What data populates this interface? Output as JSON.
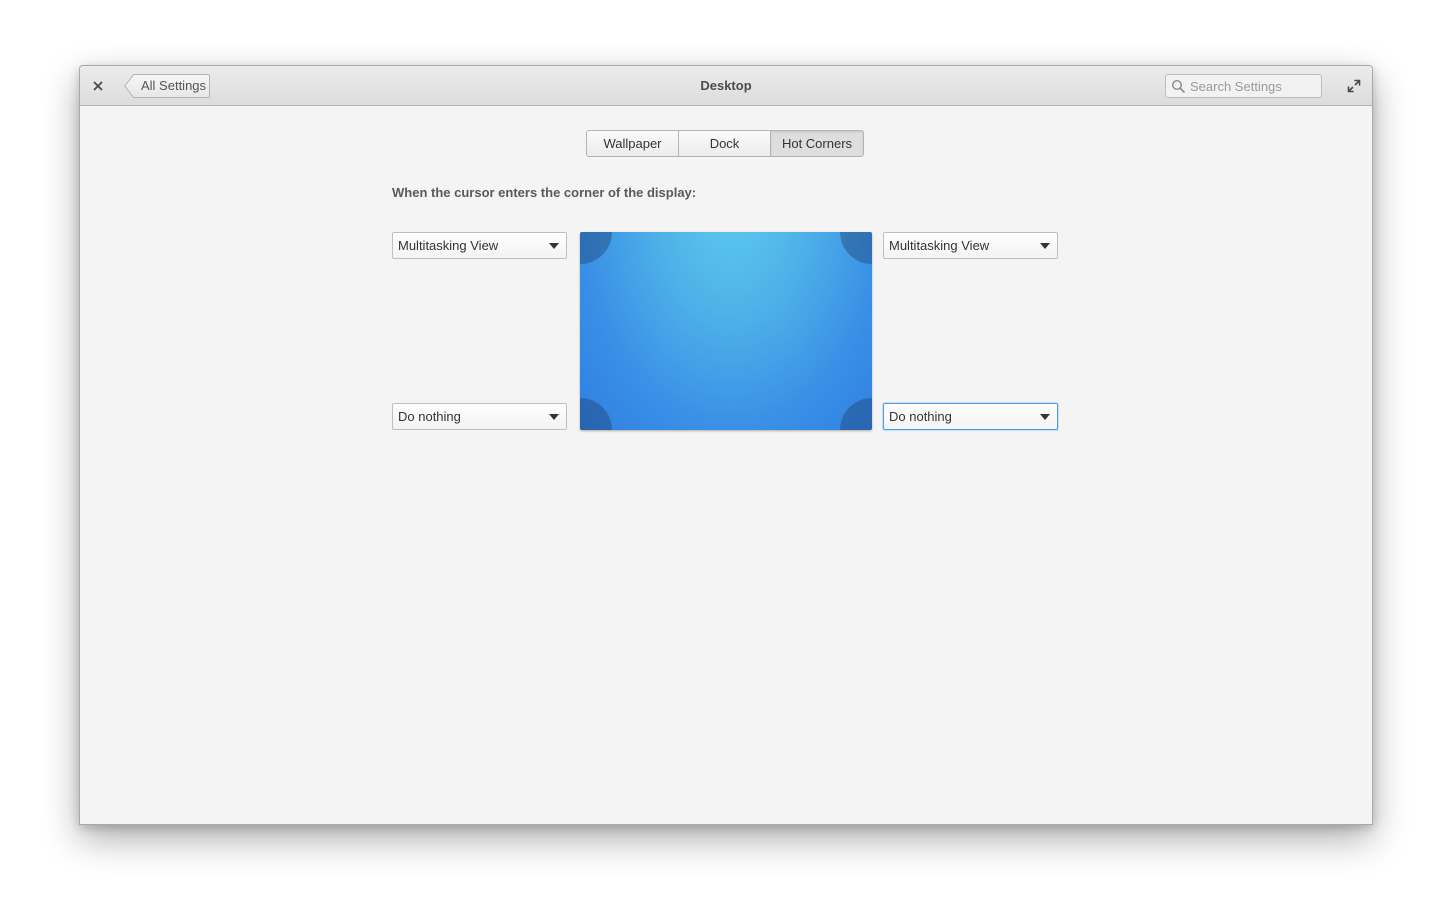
{
  "window": {
    "title": "Desktop",
    "back_label": "All Settings",
    "search_placeholder": "Search Settings",
    "close_icon": "close-icon",
    "maximize_icon": "maximize-icon"
  },
  "tabs": [
    {
      "label": "Wallpaper",
      "active": false
    },
    {
      "label": "Dock",
      "active": false
    },
    {
      "label": "Hot Corners",
      "active": true
    }
  ],
  "hot_corners": {
    "instruction": "When the cursor enters the corner of the display:",
    "top_left": "Multitasking View",
    "top_right": "Multitasking View",
    "bottom_left": "Do nothing",
    "bottom_right": "Do nothing"
  },
  "colors": {
    "accent_focus": "#4a9de6",
    "display_top": "#5ccaef",
    "display_bottom": "#2f7fe0"
  }
}
